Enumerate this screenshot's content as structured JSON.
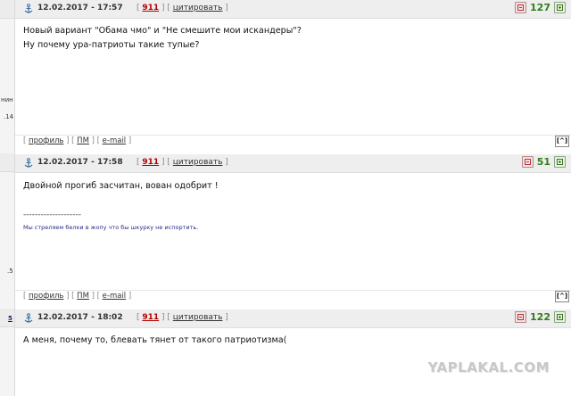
{
  "left_column": {
    "snippets": [
      "нин",
      ".14",
      ".5",
      "5"
    ]
  },
  "posts": [
    {
      "date": "12.02.2017 - 17:57",
      "number": "911",
      "quote_label": "цитировать",
      "rating": "127",
      "body_lines": [
        "Новый вариант \"Обама чмо\" и \"Не смешите мои искандеры\"?",
        "Ну почему ура-патриоты такие тупые?"
      ],
      "footer": {
        "profile": "профиль",
        "pm": "ПМ",
        "email": "e-mail",
        "up": "[^]"
      }
    },
    {
      "date": "12.02.2017 - 17:58",
      "number": "911",
      "quote_label": "цитировать",
      "rating": "51",
      "body_lines": [
        "Двойной прогиб засчитан, вован одобрит !"
      ],
      "signature_separator": "--------------------",
      "signature": "Мы стреляем белки в жопу что бы шкурку не испортить.",
      "footer": {
        "profile": "профиль",
        "pm": "ПМ",
        "email": "e-mail",
        "up": "[^]"
      }
    },
    {
      "date": "12.02.2017 - 18:02",
      "number": "911",
      "quote_label": "цитировать",
      "rating": "122",
      "body_lines": [
        "А меня, почему то, блевать тянет от такого патриотизма("
      ]
    }
  ],
  "logo_text": "YAPLAKAL.COM",
  "colors": {
    "rating_green": "#2f7d1a",
    "post_number_red": "#b30000",
    "header_bg": "#eeeeee"
  }
}
